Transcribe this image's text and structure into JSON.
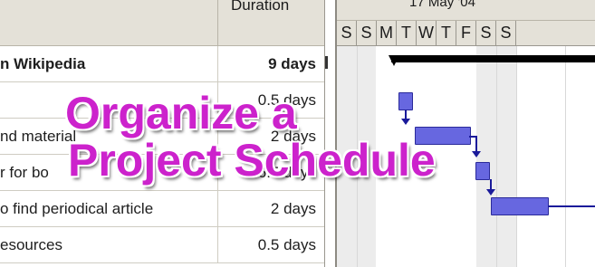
{
  "table": {
    "headers": {
      "name": "",
      "duration": "Duration"
    },
    "rows": [
      {
        "name": "n Wikipedia",
        "duration": "9 days",
        "summary": true
      },
      {
        "name": "",
        "duration": "0.5 days",
        "summary": false
      },
      {
        "name": "nd material",
        "duration": "2 days",
        "summary": false
      },
      {
        "name": "r for bo",
        "duration": "6.5 days",
        "summary": false
      },
      {
        "name": "o find periodical article",
        "duration": "2 days",
        "summary": false
      },
      {
        "name": "esources",
        "duration": "0.5 days",
        "summary": false
      }
    ]
  },
  "gantt": {
    "week_label": "17 May '04",
    "days": [
      "S",
      "S",
      "M",
      "T",
      "W",
      "T",
      "F",
      "S",
      "S"
    ],
    "bar_color": "#6767e0",
    "summary_color": "#000000"
  },
  "overlay": {
    "line1": "Organize a",
    "line2": "Project Schedule",
    "color": "#cc22cc"
  }
}
